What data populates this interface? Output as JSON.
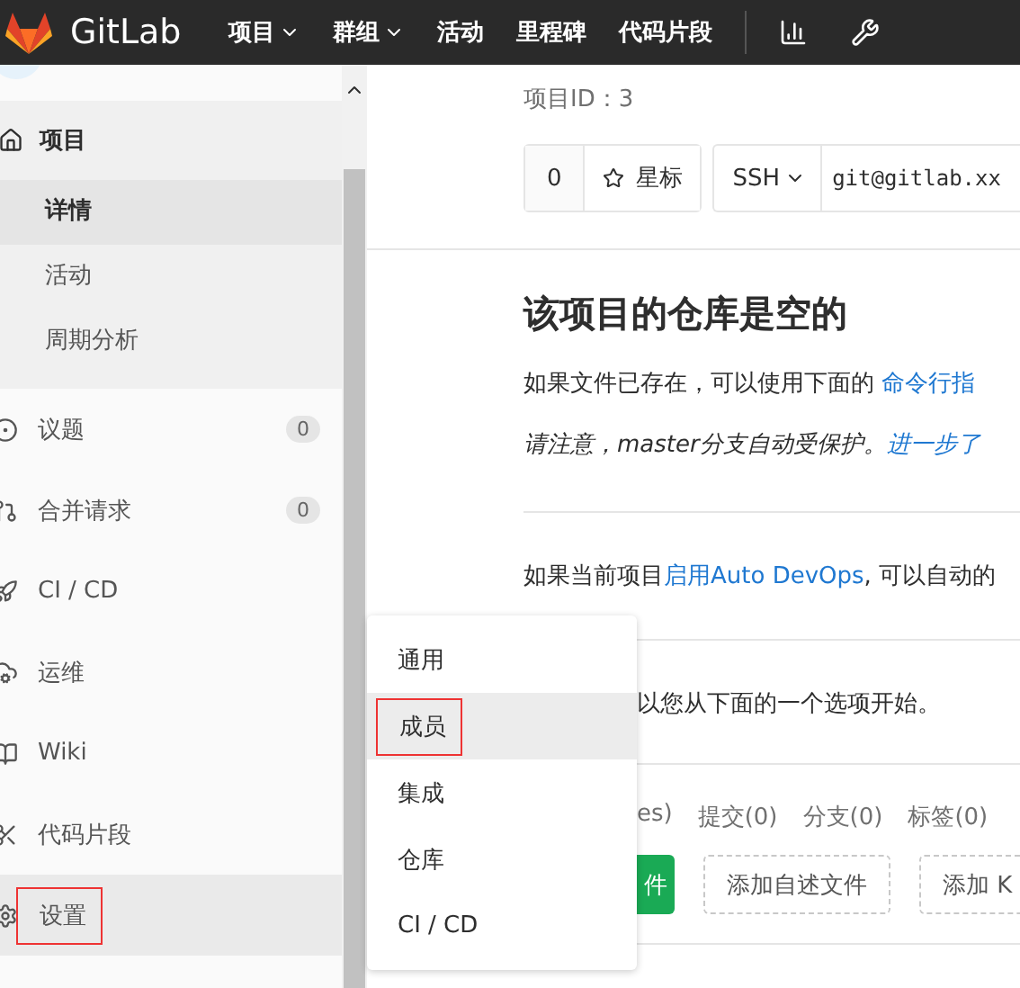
{
  "header": {
    "brand": "GitLab",
    "nav": [
      {
        "label": "项目",
        "dropdown": true
      },
      {
        "label": "群组",
        "dropdown": true
      },
      {
        "label": "活动",
        "dropdown": false
      },
      {
        "label": "里程碑",
        "dropdown": false
      },
      {
        "label": "代码片段",
        "dropdown": false
      }
    ]
  },
  "sidebar": {
    "project": {
      "label": "项目",
      "children": [
        {
          "label": "详情",
          "selected": true
        },
        {
          "label": "活动",
          "selected": false
        },
        {
          "label": "周期分析",
          "selected": false
        }
      ]
    },
    "items": [
      {
        "label": "议题",
        "badge": "0",
        "selected": false,
        "annotated": false
      },
      {
        "label": "合并请求",
        "badge": "0",
        "selected": false,
        "annotated": false
      },
      {
        "label": "CI / CD",
        "selected": false,
        "annotated": false
      },
      {
        "label": "运维",
        "selected": false,
        "annotated": false
      },
      {
        "label": "Wiki",
        "selected": false,
        "annotated": false
      },
      {
        "label": "代码片段",
        "selected": false,
        "annotated": false
      },
      {
        "label": "设置",
        "selected": true,
        "annotated": true
      }
    ]
  },
  "flyout": {
    "items": [
      {
        "label": "通用",
        "selected": false,
        "annotated": false
      },
      {
        "label": "成员",
        "selected": true,
        "annotated": true
      },
      {
        "label": "集成",
        "selected": false,
        "annotated": false
      },
      {
        "label": "仓库",
        "selected": false,
        "annotated": false
      },
      {
        "label": "CI / CD",
        "selected": false,
        "annotated": false
      }
    ]
  },
  "main": {
    "project_id": "项目ID：3",
    "star_count": "0",
    "star_label": "星标",
    "clone_protocol": "SSH",
    "clone_url": "git@gitlab.xx",
    "heading": "该项目的仓库是空的",
    "existing_files": {
      "text": "如果文件已存在，可以使用下面的",
      "link": "命令行指"
    },
    "protected_note": {
      "text": "请注意，master分支自动受保护。",
      "link": "进一步了"
    },
    "devops": {
      "before": "如果当前项目",
      "link": "启用Auto DevOps",
      "after": ", 可以自动的"
    },
    "start_hint": "以您从下面的一个选项开始。",
    "tabs": [
      "es)",
      "提交(0)",
      "分支(0)",
      "标签(0)"
    ],
    "primary_action": "件",
    "actions": [
      "添加自述文件",
      "添加 K"
    ]
  }
}
